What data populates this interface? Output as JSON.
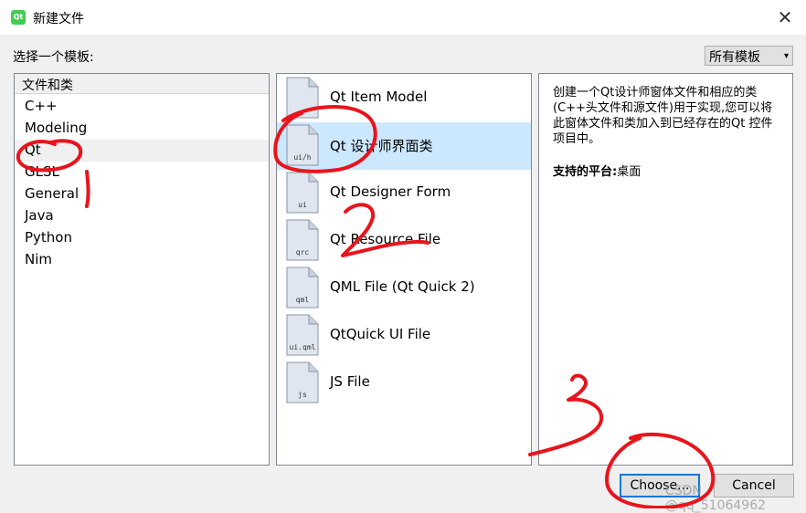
{
  "window": {
    "title": "新建文件",
    "close_glyph": "✕",
    "app_icon": "qt-logo-icon",
    "app_icon_text": "Qt"
  },
  "prompt": "选择一个模板:",
  "filter": {
    "selected": "所有模板",
    "arrow_glyph": "▾"
  },
  "categories": {
    "header": "文件和类",
    "items": [
      {
        "label": "C++"
      },
      {
        "label": "Modeling"
      },
      {
        "label": "Qt"
      },
      {
        "label": "GLSL"
      },
      {
        "label": "General"
      },
      {
        "label": "Java"
      },
      {
        "label": "Python"
      },
      {
        "label": "Nim"
      }
    ],
    "selected_index": 2
  },
  "templates": {
    "items": [
      {
        "label": "Qt Item Model",
        "ext": ""
      },
      {
        "label": "Qt 设计师界面类",
        "ext": "ui/h"
      },
      {
        "label": "Qt Designer Form",
        "ext": "ui"
      },
      {
        "label": "Qt Resource File",
        "ext": "qrc"
      },
      {
        "label": "QML File (Qt Quick 2)",
        "ext": "qml"
      },
      {
        "label": "QtQuick UI File",
        "ext": "ui.qml"
      },
      {
        "label": "JS File",
        "ext": "js"
      }
    ],
    "selected_index": 1
  },
  "description": {
    "text": "创建一个Qt设计师窗体文件和相应的类(C++头文件和源文件)用于实现,您可以将此窗体文件和类加入到已经存在的Qt 控件项目中。",
    "platform_label": "支持的平台:",
    "platform_value": "桌面"
  },
  "buttons": {
    "choose": "Choose...",
    "cancel": "Cancel"
  },
  "watermark": "CSDN @qq_51064962",
  "colors": {
    "selection": "#cce8ff",
    "focus_border": "#0078d7",
    "annotation": "#e8141c"
  }
}
